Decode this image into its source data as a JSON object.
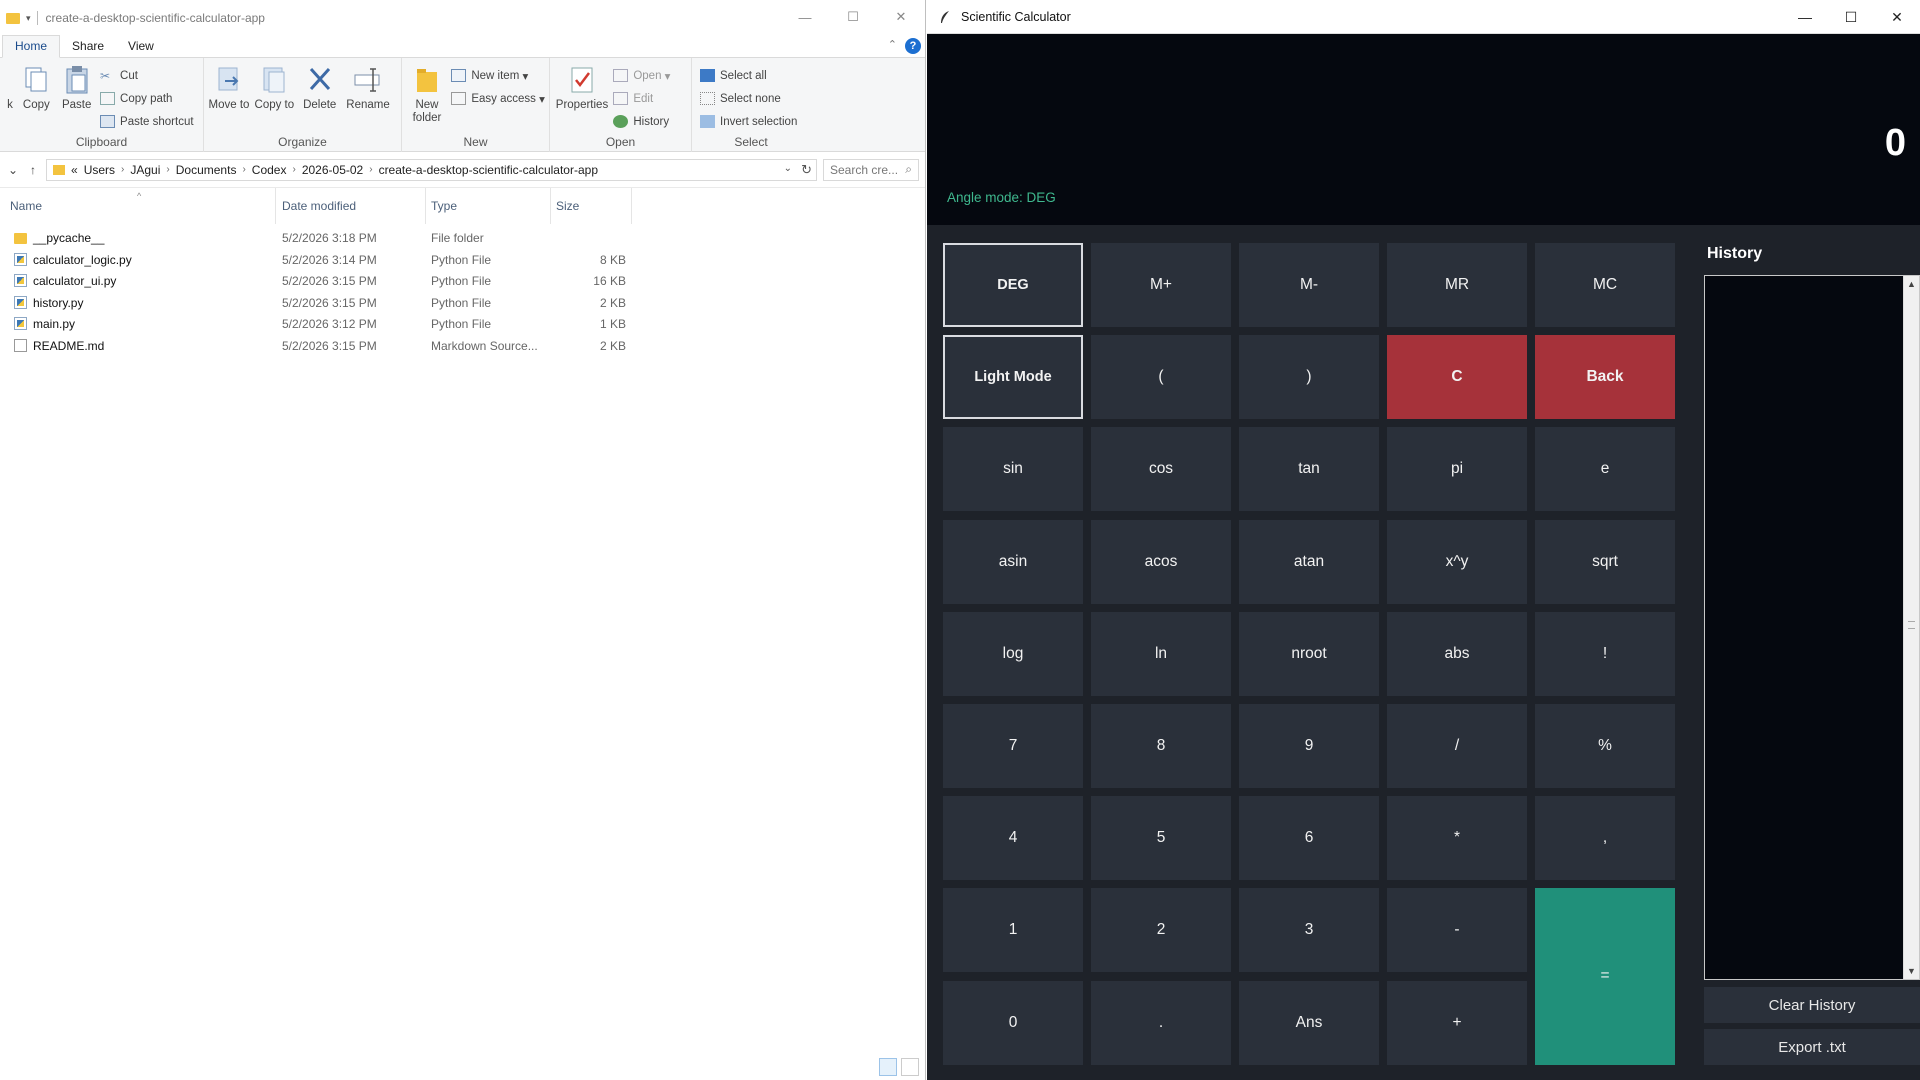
{
  "explorer": {
    "title": "create-a-desktop-scientific-calculator-app",
    "tabs": [
      "Home",
      "Share",
      "View"
    ],
    "help": "?",
    "ribbon": {
      "clipboard": {
        "label": "Clipboard",
        "pin": "k",
        "copy": "Copy",
        "paste": "Paste",
        "cut": "Cut",
        "copy_path": "Copy path",
        "paste_shortcut": "Paste shortcut"
      },
      "organize": {
        "label": "Organize",
        "move_to": "Move to",
        "copy_to": "Copy to",
        "delete": "Delete",
        "rename": "Rename"
      },
      "new": {
        "label": "New",
        "new_folder": "New folder",
        "new_item": "New item",
        "easy_access": "Easy access"
      },
      "open": {
        "label": "Open",
        "properties": "Properties",
        "open": "Open",
        "edit": "Edit",
        "history": "History"
      },
      "select": {
        "label": "Select",
        "select_all": "Select all",
        "select_none": "Select none",
        "invert_selection": "Invert selection"
      }
    },
    "address": {
      "prefix": "«",
      "crumbs": [
        "Users",
        "JAgui",
        "Documents",
        "Codex",
        "2026-05-02",
        "create-a-desktop-scientific-calculator-app"
      ],
      "search_placeholder": "Search cre..."
    },
    "columns": [
      "Name",
      "Date modified",
      "Type",
      "Size"
    ],
    "files": [
      {
        "name": "__pycache__",
        "date": "5/2/2026 3:18 PM",
        "type": "File folder",
        "size": "",
        "kind": "folder"
      },
      {
        "name": "calculator_logic.py",
        "date": "5/2/2026 3:14 PM",
        "type": "Python File",
        "size": "8 KB",
        "kind": "py"
      },
      {
        "name": "calculator_ui.py",
        "date": "5/2/2026 3:15 PM",
        "type": "Python File",
        "size": "16 KB",
        "kind": "py"
      },
      {
        "name": "history.py",
        "date": "5/2/2026 3:15 PM",
        "type": "Python File",
        "size": "2 KB",
        "kind": "py"
      },
      {
        "name": "main.py",
        "date": "5/2/2026 3:12 PM",
        "type": "Python File",
        "size": "1 KB",
        "kind": "py"
      },
      {
        "name": "README.md",
        "date": "5/2/2026 3:15 PM",
        "type": "Markdown Source...",
        "size": "2 KB",
        "kind": "md"
      }
    ]
  },
  "calculator": {
    "title": "Scientific Calculator",
    "display_value": "0",
    "angle_mode": "Angle mode: DEG",
    "keys": [
      [
        "DEG",
        "M+",
        "M-",
        "MR",
        "MC"
      ],
      [
        "Light Mode",
        "(",
        ")",
        "C",
        "Back"
      ],
      [
        "sin",
        "cos",
        "tan",
        "pi",
        "e"
      ],
      [
        "asin",
        "acos",
        "atan",
        "x^y",
        "sqrt"
      ],
      [
        "log",
        "ln",
        "nroot",
        "abs",
        "!"
      ],
      [
        "7",
        "8",
        "9",
        "/",
        "%"
      ],
      [
        "4",
        "5",
        "6",
        "*",
        ","
      ],
      [
        "1",
        "2",
        "3",
        "-",
        "="
      ],
      [
        "0",
        ".",
        "Ans",
        "+"
      ]
    ],
    "history_label": "History",
    "clear_history": "Clear History",
    "export": "Export .txt",
    "colors": {
      "background": "#1e2229",
      "display": "#05080f",
      "key": "#2a303a",
      "danger": "#a6323a",
      "equals": "#20907a",
      "angle_text": "#3fb88e"
    }
  }
}
